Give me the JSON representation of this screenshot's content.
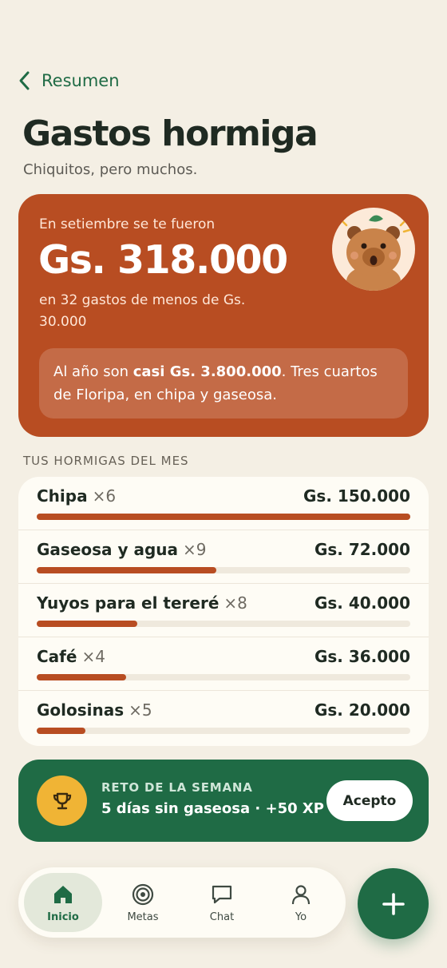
{
  "header": {
    "back_label": "Resumen",
    "title": "Gastos hormiga",
    "subtitle": "Chiquitos, pero muchos."
  },
  "hero": {
    "lead": "En setiembre se te fueron",
    "amount": "Gs. 318.000",
    "detail": "en 32 gastos de menos de Gs. 30.000",
    "note_prefix": "Al año son ",
    "note_bold": "casi Gs. 3.800.000",
    "note_suffix": ". Tres cuartos de Floripa, en chipa y gaseosa.",
    "avatar_icon": "capybara-mascot-icon"
  },
  "list": {
    "section_label": "TUS HORMIGAS DEL MES",
    "items": [
      {
        "name": "Chipa",
        "count": "×6",
        "value": "Gs. 150.000",
        "ratio": 1.0
      },
      {
        "name": "Gaseosa y agua",
        "count": "×9",
        "value": "Gs. 72.000",
        "ratio": 0.48
      },
      {
        "name": "Yuyos para el tereré",
        "count": "×8",
        "value": "Gs. 40.000",
        "ratio": 0.27
      },
      {
        "name": "Café",
        "count": "×4",
        "value": "Gs. 36.000",
        "ratio": 0.24
      },
      {
        "name": "Golosinas",
        "count": "×5",
        "value": "Gs. 20.000",
        "ratio": 0.13
      }
    ]
  },
  "challenge": {
    "kicker": "RETO DE LA SEMANA",
    "headline": "5 días sin gaseosa · +50 XP",
    "accept_label": "Acepto",
    "icon": "trophy-icon"
  },
  "nav": {
    "items": [
      {
        "label": "Inicio",
        "icon": "home-icon",
        "active": true
      },
      {
        "label": "Metas",
        "icon": "target-icon",
        "active": false
      },
      {
        "label": "Chat",
        "icon": "chat-icon",
        "active": false
      },
      {
        "label": "Yo",
        "icon": "profile-icon",
        "active": false
      }
    ],
    "fab_icon": "plus-icon"
  },
  "colors": {
    "background": "#f4efe4",
    "accent_green": "#1f6b45",
    "accent_rust": "#b84d22",
    "gold": "#f0b435"
  }
}
